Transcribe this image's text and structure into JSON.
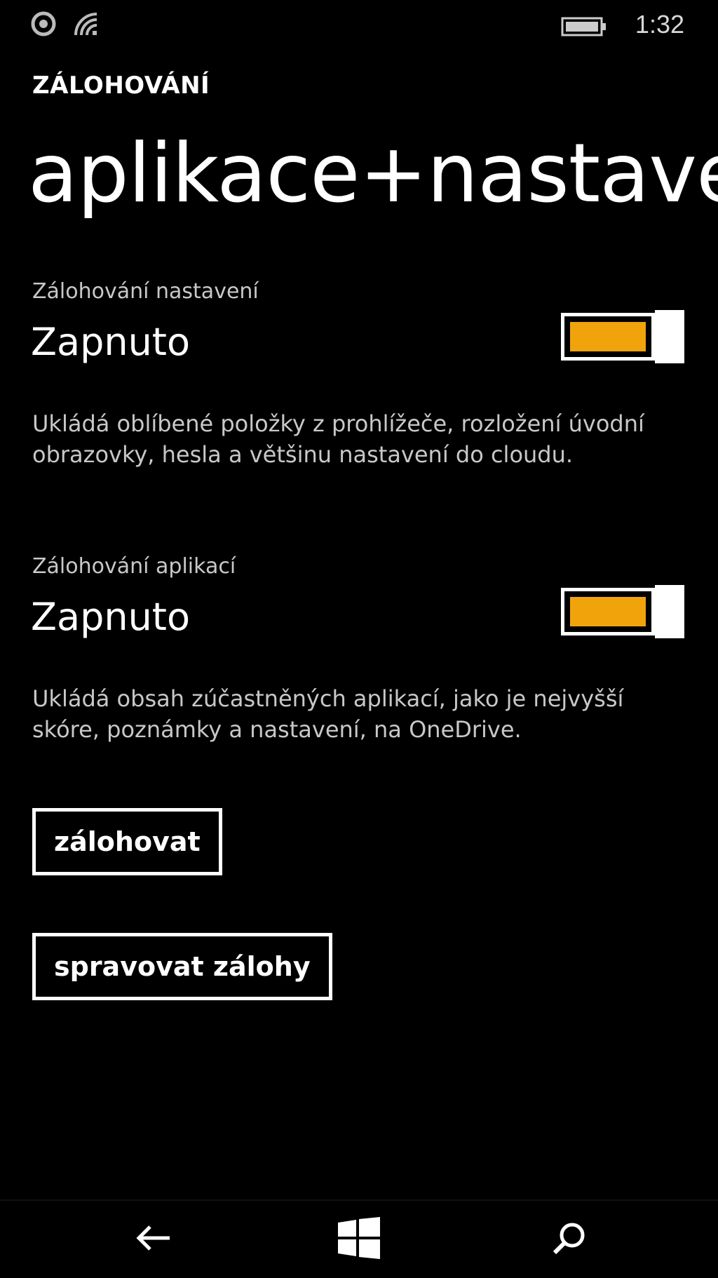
{
  "status_bar": {
    "time": "1:32",
    "icons": [
      "notification-icon",
      "signal-icon",
      "battery-icon"
    ]
  },
  "header": {
    "section": "ZÁLOHOVÁNÍ",
    "title": "aplikace+nastavení"
  },
  "settings_backup": {
    "label": "Zálohování nastavení",
    "value": "Zapnuto",
    "toggle_on": true,
    "description": "Ukládá oblíbené položky z prohlížeče, rozložení úvodní obrazovky, hesla a většinu nastavení do cloudu."
  },
  "apps_backup": {
    "label": "Zálohování aplikací",
    "value": "Zapnuto",
    "toggle_on": true,
    "description": "Ukládá obsah zúčastněných aplikací, jako je nejvyšší skóre, poznámky a nastavení, na OneDrive."
  },
  "buttons": {
    "backup": "zálohovat",
    "manage": "spravovat zálohy"
  },
  "nav": {
    "back": "back-arrow-icon",
    "start": "windows-logo-icon",
    "search": "search-icon"
  },
  "colors": {
    "background": "#000000",
    "accent": "#f0a30a",
    "text": "#ffffff",
    "secondary_text": "#c8c8c8"
  }
}
